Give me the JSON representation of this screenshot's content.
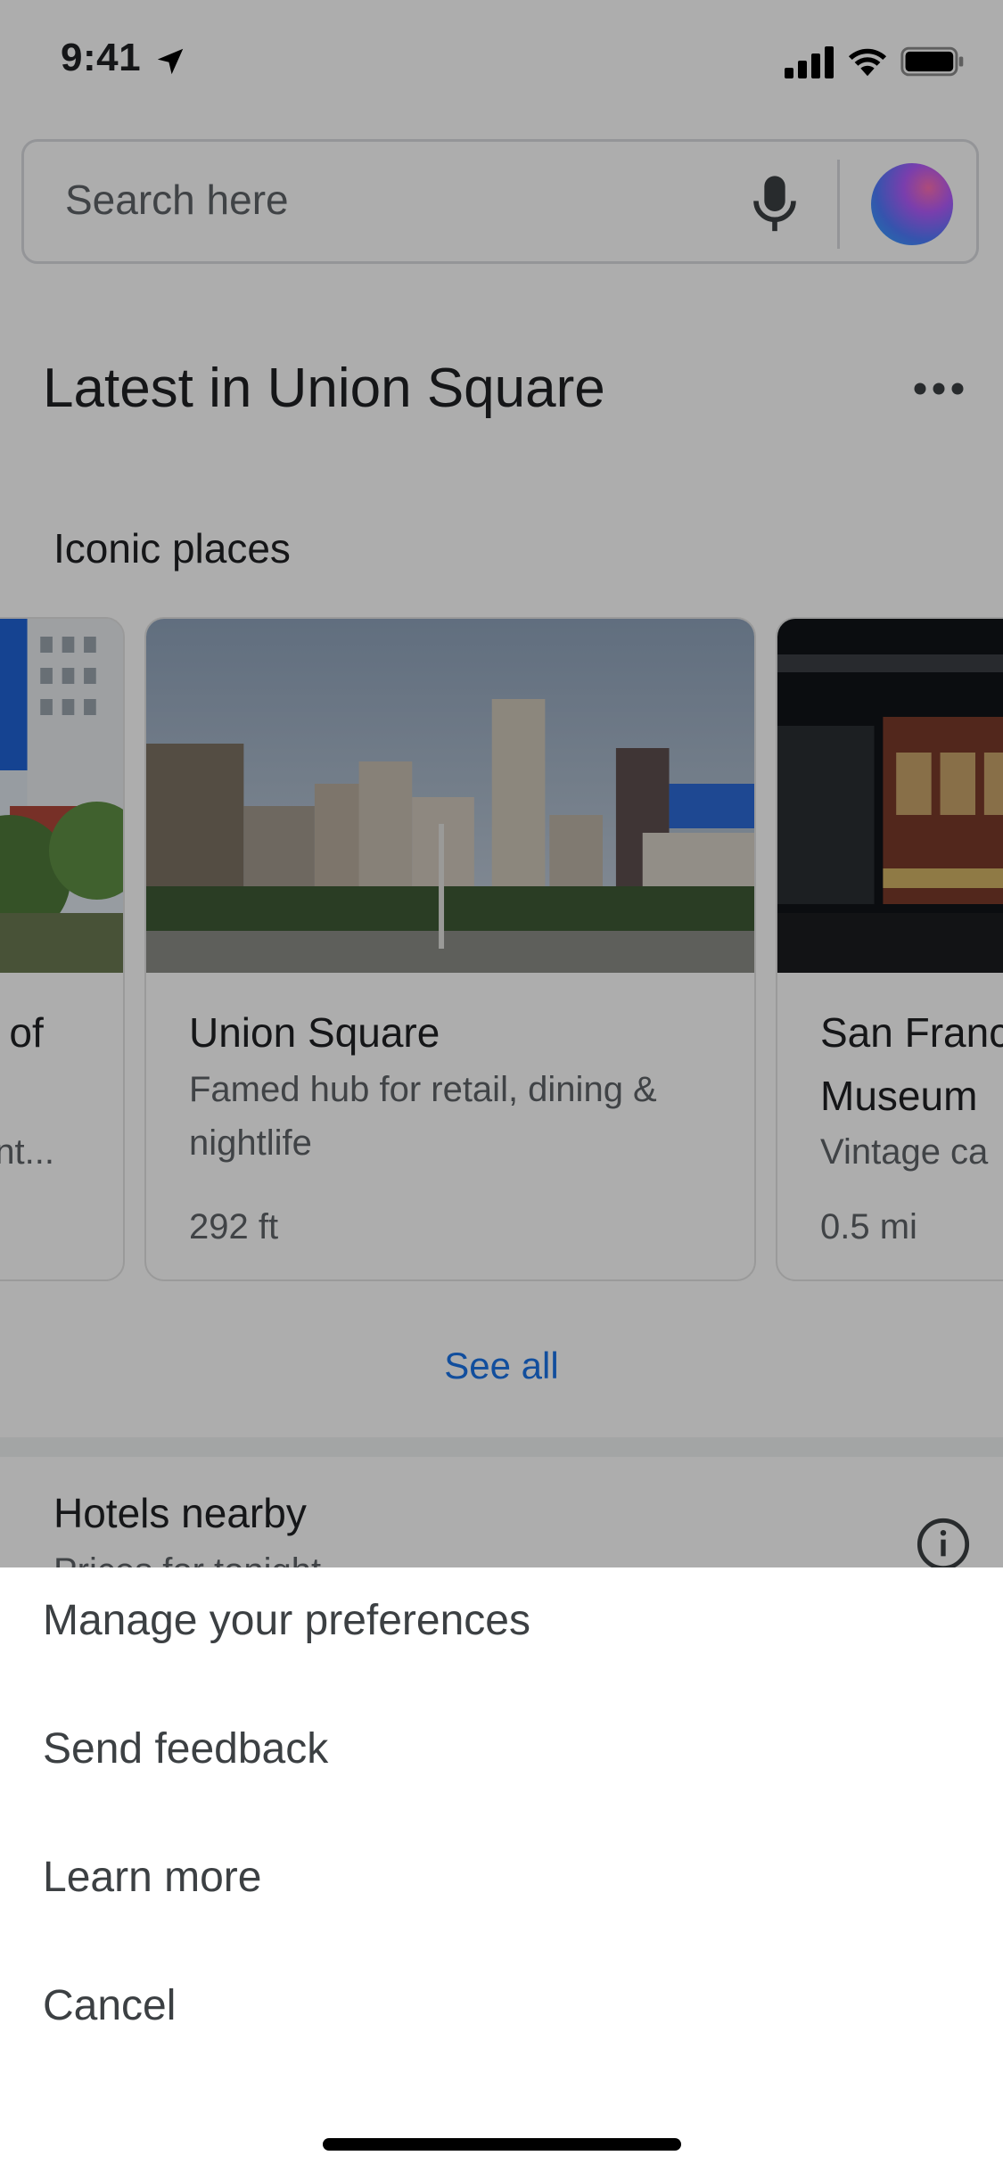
{
  "status_bar": {
    "time": "9:41"
  },
  "search": {
    "placeholder": "Search here"
  },
  "section": {
    "title": "Latest in Union Square",
    "subtitle": "Iconic places"
  },
  "cards": [
    {
      "title_partial": "n of",
      "desc_partial": "ent..."
    },
    {
      "title": "Union Square",
      "desc_line1": "Famed hub for retail, dining &",
      "desc_line2": "nightlife",
      "distance": "292 ft"
    },
    {
      "title_line1": "San Franc",
      "title_line2": "Museum",
      "desc_partial": "Vintage ca",
      "distance": "0.5 mi"
    }
  ],
  "see_all": "See all",
  "hotels": {
    "title": "Hotels nearby",
    "subtitle": "Prices for tonight"
  },
  "menu": {
    "items": [
      {
        "label": "Manage your preferences"
      },
      {
        "label": "Send feedback"
      },
      {
        "label": "Learn more"
      },
      {
        "label": "Cancel"
      }
    ]
  },
  "colors": {
    "accent": "#1a73e8",
    "scrim": "rgba(0,0,0,0.32)"
  }
}
